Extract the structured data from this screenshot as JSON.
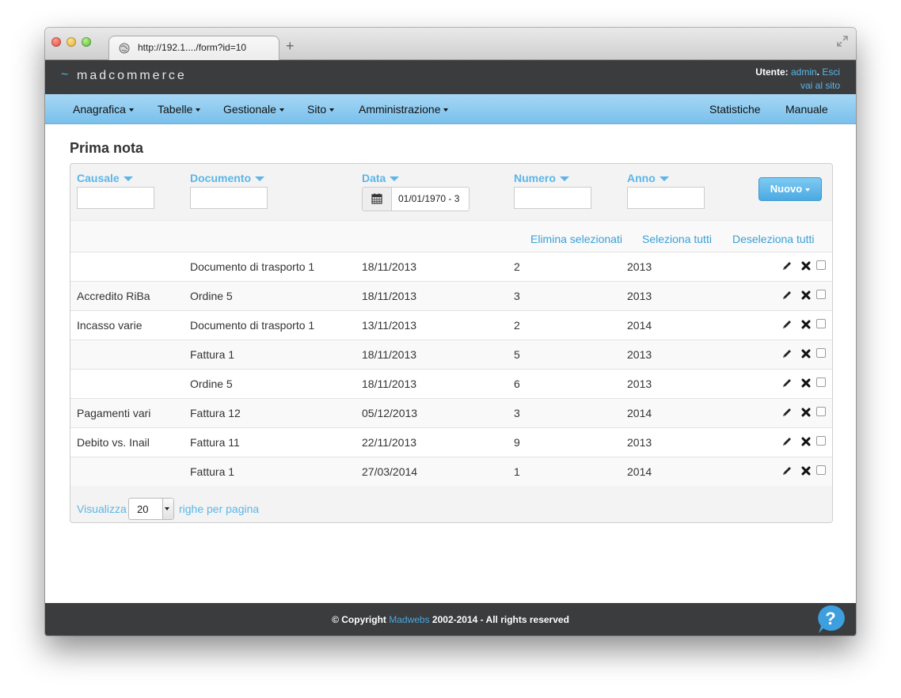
{
  "browser": {
    "url": "http://192.1..../form?id=10"
  },
  "header": {
    "logo_tilde": "~",
    "logo": "madcommerce",
    "user_label": "Utente: ",
    "user_name": "admin",
    "user_sep": ". ",
    "logout": "Esci",
    "goto_site": "vai al sito"
  },
  "nav": {
    "left": [
      "Anagrafica",
      "Tabelle",
      "Gestionale",
      "Sito",
      "Amministrazione"
    ],
    "right": [
      "Statistiche",
      "Manuale"
    ]
  },
  "page": {
    "title": "Prima nota"
  },
  "filters": {
    "causale": "Causale",
    "documento": "Documento",
    "data": "Data",
    "data_value": "01/01/1970 - 3",
    "numero": "Numero",
    "anno": "Anno",
    "new_button": "Nuovo"
  },
  "actions": {
    "delete_selected": "Elimina selezionati",
    "select_all": "Seleziona tutti",
    "deselect_all": "Deseleziona tutti"
  },
  "rows": [
    {
      "causale": "",
      "documento": "Documento di trasporto 1",
      "data": "18/11/2013",
      "numero": "2",
      "anno": "2013"
    },
    {
      "causale": "Accredito RiBa",
      "documento": "Ordine 5",
      "data": "18/11/2013",
      "numero": "3",
      "anno": "2013"
    },
    {
      "causale": "Incasso varie",
      "documento": "Documento di trasporto 1",
      "data": "13/11/2013",
      "numero": "2",
      "anno": "2014"
    },
    {
      "causale": "",
      "documento": "Fattura 1",
      "data": "18/11/2013",
      "numero": "5",
      "anno": "2013"
    },
    {
      "causale": "",
      "documento": "Ordine 5",
      "data": "18/11/2013",
      "numero": "6",
      "anno": "2013"
    },
    {
      "causale": "Pagamenti vari",
      "documento": "Fattura 12",
      "data": "05/12/2013",
      "numero": "3",
      "anno": "2014"
    },
    {
      "causale": "Debito vs. Inail",
      "documento": "Fattura 11",
      "data": "22/11/2013",
      "numero": "9",
      "anno": "2013"
    },
    {
      "causale": "",
      "documento": "Fattura 1",
      "data": "27/03/2014",
      "numero": "1",
      "anno": "2014"
    }
  ],
  "pager": {
    "show": "Visualizza",
    "per_page_value": "20",
    "rows_per_page": "righe per pagina"
  },
  "footer": {
    "prefix": "© Copyright ",
    "company": "Madwebs",
    "suffix": " 2002-2014 - All rights reserved"
  },
  "colors": {
    "accent": "#5bb6e8",
    "header_bg": "#3a3c3e",
    "nav_bg": "#79c0ec",
    "primary_button": "#4ba9e2"
  },
  "icons": {
    "row_edit": "pencil-icon",
    "row_delete": "cross-icon",
    "help": "question-bubble-icon",
    "calendar": "calendar-icon"
  }
}
